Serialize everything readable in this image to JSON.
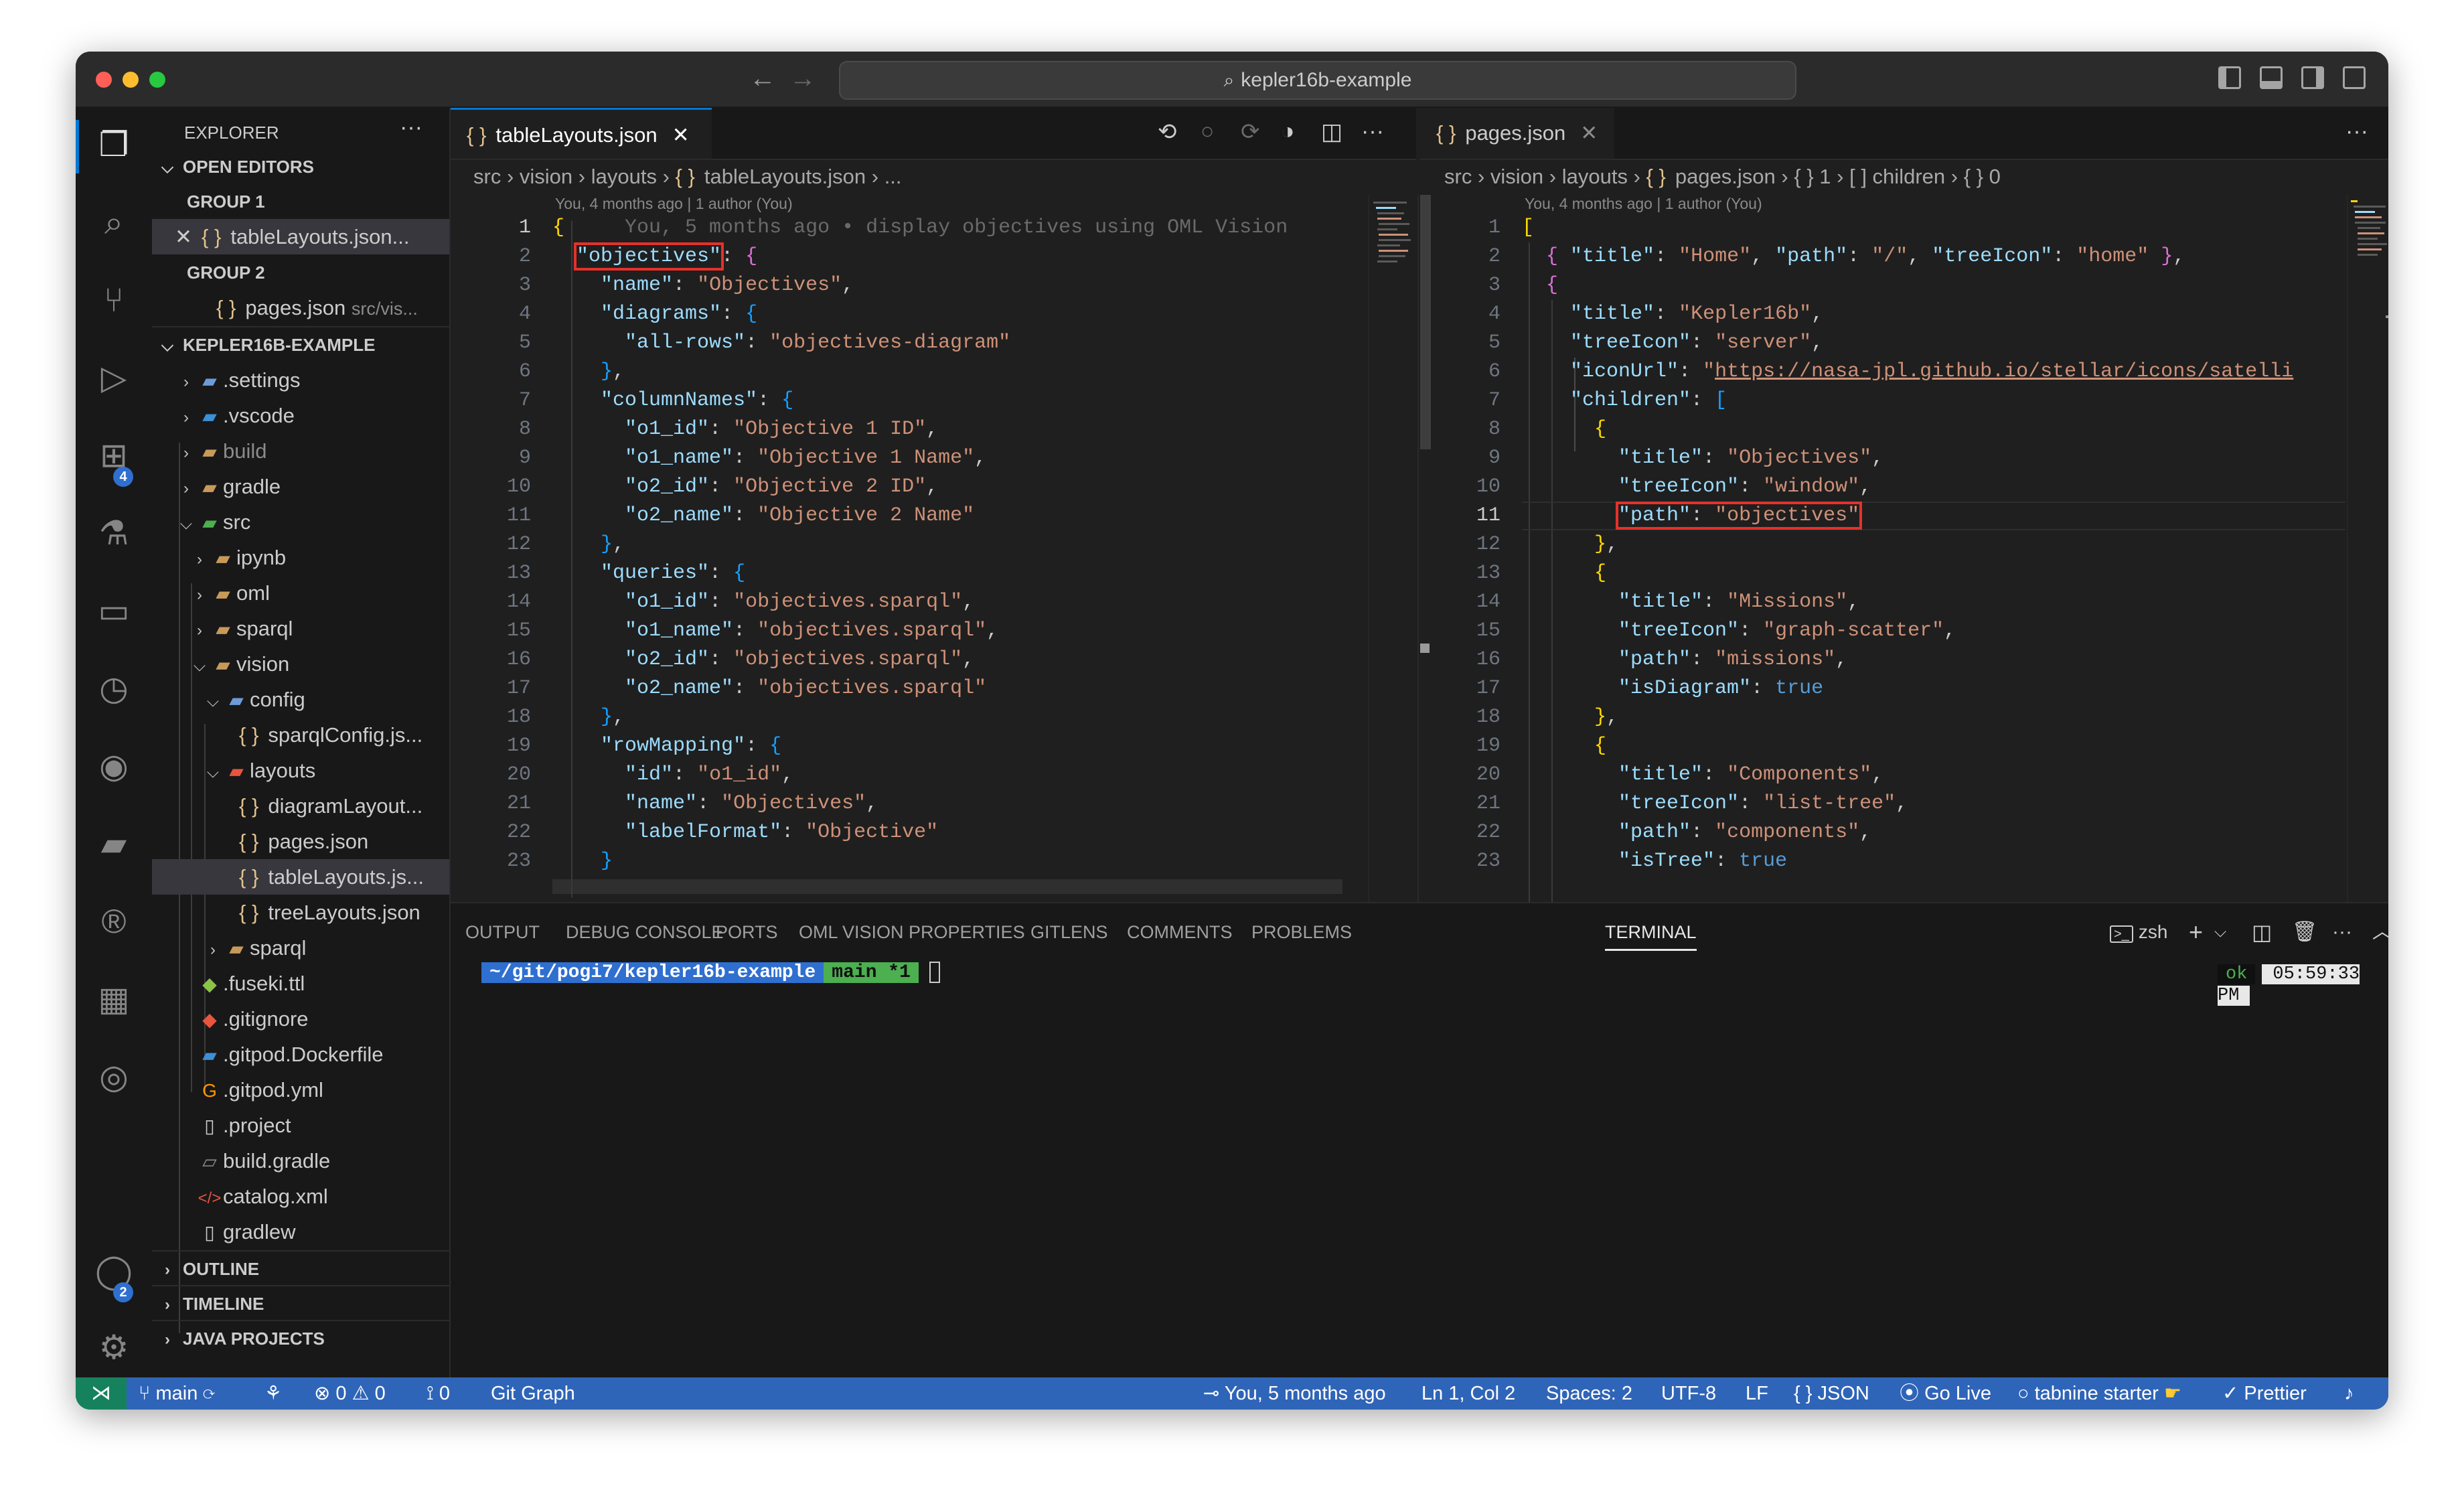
{
  "window": {
    "search_text": "kepler16b-example"
  },
  "activity_bar": {
    "extensions_badge": "4",
    "accounts_badge": "2"
  },
  "sidebar": {
    "title": "EXPLORER",
    "more": "···",
    "open_editors": {
      "label": "OPEN EDITORS",
      "group1": "GROUP 1",
      "group1_file": "tableLayouts.json...",
      "group2": "GROUP 2",
      "group2_file": "pages.json",
      "group2_path": "src/vis..."
    },
    "project_label": "KEPLER16B-EXAMPLE",
    "tree": [
      {
        "label": ".settings"
      },
      {
        "label": ".vscode"
      },
      {
        "label": "build"
      },
      {
        "label": "gradle"
      },
      {
        "label": "src"
      },
      {
        "label": "ipynb"
      },
      {
        "label": "oml"
      },
      {
        "label": "sparql"
      },
      {
        "label": "vision"
      },
      {
        "label": "config"
      },
      {
        "label": "sparqlConfig.js..."
      },
      {
        "label": "layouts"
      },
      {
        "label": "diagramLayout..."
      },
      {
        "label": "pages.json"
      },
      {
        "label": "tableLayouts.js..."
      },
      {
        "label": "treeLayouts.json"
      },
      {
        "label": "sparql"
      },
      {
        "label": ".fuseki.ttl"
      },
      {
        "label": ".gitignore"
      },
      {
        "label": ".gitpod.Dockerfile"
      },
      {
        "label": ".gitpod.yml"
      },
      {
        "label": ".project"
      },
      {
        "label": "build.gradle"
      },
      {
        "label": "catalog.xml"
      },
      {
        "label": "gradlew"
      }
    ],
    "outline": "OUTLINE",
    "timeline": "TIMELINE",
    "java_projects": "JAVA PROJECTS"
  },
  "editor_left": {
    "tab_label": "tableLayouts.json",
    "breadcrumb": {
      "c1": "src",
      "c2": "vision",
      "c3": "layouts",
      "c4": "tableLayouts.json",
      "c5": "..."
    },
    "blame_header": "You, 4 months ago | 1 author (You)",
    "inline_blame": "You, 5 months ago • display objectives using OML Vision",
    "line_numbers": [
      "1",
      "2",
      "3",
      "4",
      "5",
      "6",
      "7",
      "8",
      "9",
      "10",
      "11",
      "12",
      "13",
      "14",
      "15",
      "16",
      "17",
      "18",
      "19",
      "20",
      "21",
      "22",
      "23"
    ]
  },
  "editor_right": {
    "tab_label": "pages.json",
    "breadcrumb": {
      "c1": "src",
      "c2": "vision",
      "c3": "layouts",
      "c4": "pages.json",
      "c5": "{ } 1",
      "c6": "[ ] children",
      "c7": "{ } 0"
    },
    "blame_header": "You, 4 months ago | 1 author (You)",
    "line_numbers": [
      "1",
      "2",
      "3",
      "4",
      "5",
      "6",
      "7",
      "8",
      "9",
      "10",
      "11",
      "12",
      "13",
      "14",
      "15",
      "16",
      "17",
      "18",
      "19",
      "20",
      "21",
      "22",
      "23"
    ]
  },
  "panel": {
    "tabs": [
      "OUTPUT",
      "DEBUG CONSOLE",
      "PORTS",
      "OML VISION PROPERTIES",
      "GITLENS",
      "COMMENTS",
      "PROBLEMS",
      "TERMINAL"
    ],
    "shell": "zsh",
    "prompt_path": "~/git/pogi7/kepler16b-example",
    "prompt_branch": "main *1",
    "status_ok": "ok",
    "clock": "05:59:33 PM"
  },
  "statusbar": {
    "branch": "main",
    "errors": "0",
    "warnings": "0",
    "ports": "0",
    "git_graph": "Git Graph",
    "blame": "You, 5 months ago",
    "position": "Ln 1, Col 2",
    "spaces": "Spaces: 2",
    "encoding": "UTF-8",
    "eol": "LF",
    "language": "JSON",
    "go_live": "Go Live",
    "tabnine": "tabnine starter",
    "prettier": "Prettier"
  }
}
